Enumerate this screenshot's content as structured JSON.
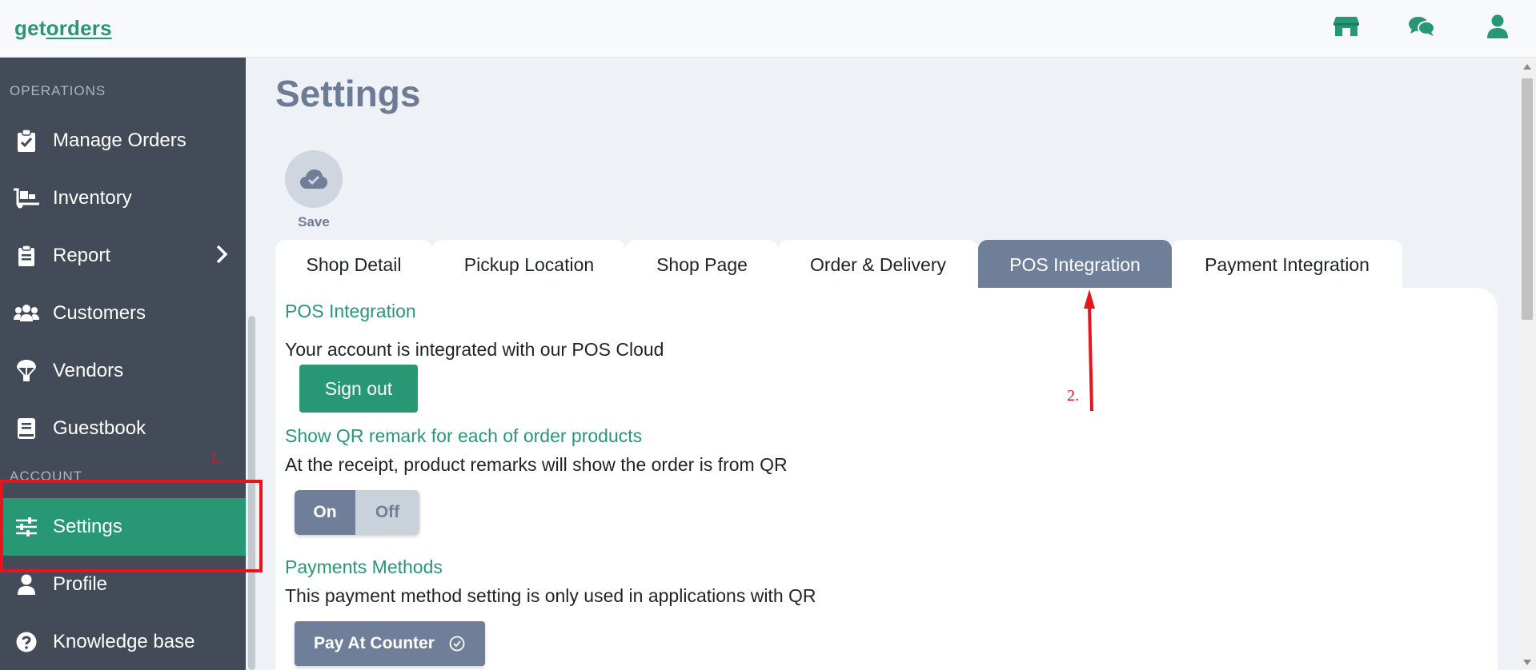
{
  "header": {
    "logo_prefix": "get",
    "logo_suffix": "orders",
    "icons": [
      "store-icon",
      "chat-icon",
      "user-icon"
    ]
  },
  "sidebar": {
    "section_operations": "OPERATIONS",
    "section_account": "ACCOUNT",
    "items": [
      {
        "label": "Manage Orders",
        "icon": "clipboard-check-icon"
      },
      {
        "label": "Inventory",
        "icon": "dolly-icon"
      },
      {
        "label": "Report",
        "icon": "report-icon"
      },
      {
        "label": "Customers",
        "icon": "users-icon"
      },
      {
        "label": "Vendors",
        "icon": "parachute-icon"
      },
      {
        "label": "Guestbook",
        "icon": "book-icon"
      },
      {
        "label": "Settings",
        "icon": "sliders-icon",
        "active": true
      },
      {
        "label": "Profile",
        "icon": "user-icon"
      },
      {
        "label": "Knowledge base",
        "icon": "question-circle-icon"
      }
    ]
  },
  "main": {
    "title": "Settings",
    "save_label": "Save",
    "tabs": [
      {
        "label": "Shop Detail"
      },
      {
        "label": "Pickup Location"
      },
      {
        "label": "Shop Page"
      },
      {
        "label": "Order & Delivery"
      },
      {
        "label": "POS Integration",
        "active": true
      },
      {
        "label": "Payment Integration"
      }
    ],
    "pos": {
      "title": "POS Integration",
      "status_text": "Your account is integrated with our POS Cloud",
      "signout_label": "Sign out"
    },
    "qr_remark": {
      "title": "Show QR remark for each of order products",
      "description": "At the receipt, product remarks will show the order is from QR",
      "on_label": "On",
      "off_label": "Off",
      "selected": "On"
    },
    "payments": {
      "title": "Payments Methods",
      "description": "This payment method setting is only used in applications with QR",
      "method_label": "Pay At Counter"
    }
  },
  "annotations": {
    "step1": "1.",
    "step2": "2."
  },
  "colors": {
    "brand_green": "#279873",
    "sidebar_bg": "#444b58",
    "tab_active": "#6f7f99",
    "annotation_red": "#e8141c"
  }
}
